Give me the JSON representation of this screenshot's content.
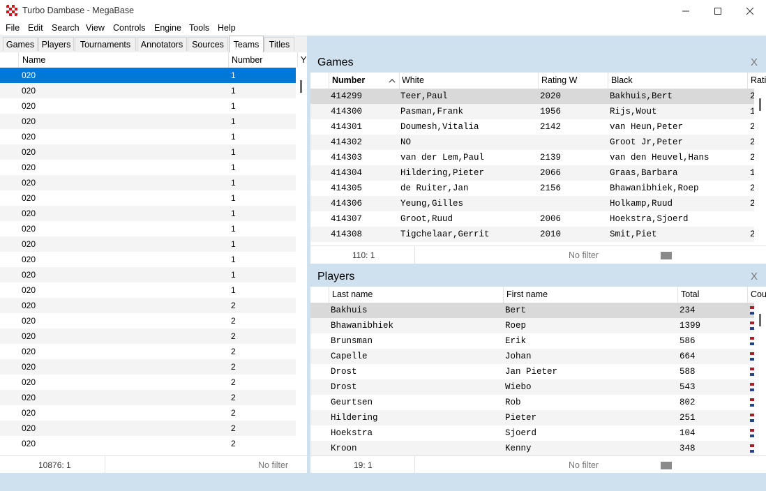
{
  "window": {
    "title": "Turbo Dambase - MegaBase"
  },
  "menu": [
    "File",
    "Edit",
    "Search",
    "View",
    "Controls",
    "Engine",
    "Tools",
    "Help"
  ],
  "tabs": [
    "Games",
    "Players",
    "Tournaments",
    "Annotators",
    "Sources",
    "Teams",
    "Titles"
  ],
  "active_tab": "Teams",
  "left_grid": {
    "headers": [
      "Name",
      "Number",
      "Y"
    ],
    "rows": [
      [
        "020",
        "1"
      ],
      [
        "020",
        "1"
      ],
      [
        "020",
        "1"
      ],
      [
        "020",
        "1"
      ],
      [
        "020",
        "1"
      ],
      [
        "020",
        "1"
      ],
      [
        "020",
        "1"
      ],
      [
        "020",
        "1"
      ],
      [
        "020",
        "1"
      ],
      [
        "020",
        "1"
      ],
      [
        "020",
        "1"
      ],
      [
        "020",
        "1"
      ],
      [
        "020",
        "1"
      ],
      [
        "020",
        "1"
      ],
      [
        "020",
        "1"
      ],
      [
        "020",
        "2"
      ],
      [
        "020",
        "2"
      ],
      [
        "020",
        "2"
      ],
      [
        "020",
        "2"
      ],
      [
        "020",
        "2"
      ],
      [
        "020",
        "2"
      ],
      [
        "020",
        "2"
      ],
      [
        "020",
        "2"
      ],
      [
        "020",
        "2"
      ],
      [
        "020",
        "2"
      ]
    ],
    "status_count": "10876: 1",
    "status_filter": "No filter"
  },
  "games_panel": {
    "title": "Games",
    "close": "X",
    "headers": [
      "Number",
      "White",
      "Rating W",
      "Black",
      "Rati"
    ],
    "sort_column": "Number",
    "rows": [
      [
        "414299",
        "Teer,Paul",
        "2020",
        "Bakhuis,Bert",
        "2"
      ],
      [
        "414300",
        "Pasman,Frank",
        "1956",
        "Rijs,Wout",
        "1"
      ],
      [
        "414301",
        "Doumesh,Vitalia",
        "2142",
        "van Heun,Peter",
        "2"
      ],
      [
        "414302",
        "NO",
        "",
        "Groot Jr,Peter",
        "2"
      ],
      [
        "414303",
        "van der Lem,Paul",
        "2139",
        "van den Heuvel,Hans",
        "2"
      ],
      [
        "414304",
        "Hildering,Pieter",
        "2066",
        "Graas,Barbara",
        "1"
      ],
      [
        "414305",
        "de Ruiter,Jan",
        "2156",
        "Bhawanibhiek,Roep",
        "2"
      ],
      [
        "414306",
        "Yeung,Gilles",
        "",
        "Holkamp,Ruud",
        "2"
      ],
      [
        "414307",
        "Groot,Ruud",
        "2006",
        "Hoekstra,Sjoerd",
        ""
      ],
      [
        "414308",
        "Tigchelaar,Gerrit",
        "2010",
        "Smit,Piet",
        "2"
      ]
    ],
    "status_count": "110: 1",
    "status_filter": "No filter"
  },
  "players_panel": {
    "title": "Players",
    "close": "X",
    "headers": [
      "Last name",
      "First name",
      "Total",
      "Cou"
    ],
    "rows": [
      [
        "Bakhuis",
        "Bert",
        "234"
      ],
      [
        "Bhawanibhiek",
        "Roep",
        "1399"
      ],
      [
        "Brunsman",
        "Erik",
        "586"
      ],
      [
        "Capelle",
        "Johan",
        "664"
      ],
      [
        "Drost",
        "Jan Pieter",
        "588"
      ],
      [
        "Drost",
        "Wiebo",
        "543"
      ],
      [
        "Geurtsen",
        "Rob",
        "802"
      ],
      [
        "Hildering",
        "Pieter",
        "251"
      ],
      [
        "Hoekstra",
        "Sjoerd",
        "104"
      ],
      [
        "Kroon",
        "Kenny",
        "348"
      ]
    ],
    "country_flag_icon": "netherlands-flag-icon",
    "status_count": "19: 1",
    "status_filter": "No filter"
  },
  "colors": {
    "accent_blue": "#0078d7",
    "panel_blue": "#cfe0ee",
    "selected_gray": "#d9d9d9",
    "flag_red": "#ae1c28",
    "flag_blue": "#21468b"
  }
}
